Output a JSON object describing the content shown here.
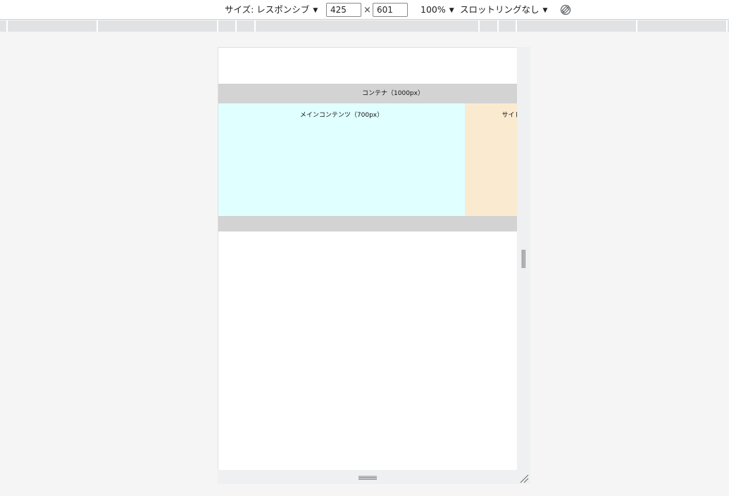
{
  "toolbar": {
    "size_label": "サイズ: レスポンシブ",
    "width_value": "425",
    "times_sign": "×",
    "height_value": "601",
    "zoom_label": "100%",
    "throttle_label": "スロットリングなし",
    "caret": "▼"
  },
  "page": {
    "container_label": "コンテナ（1000px）",
    "main_label": "メインコンテンツ（700px）",
    "sidebar_label": "サイドバー"
  },
  "colors": {
    "container": "#d3d3d3",
    "main": "#e0ffff",
    "sidebar": "#faebd0"
  },
  "icons": {
    "rotate": "rotate-icon",
    "resize_right": "resize-handle-icon",
    "resize_bottom": "resize-handle-icon",
    "resize_corner": "resize-corner-icon"
  }
}
